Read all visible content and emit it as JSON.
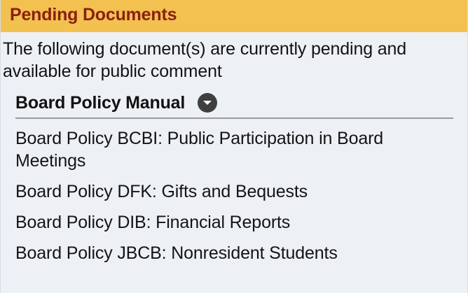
{
  "panel": {
    "title": "Pending Documents",
    "intro": "The following document(s) are currently pending and available for public comment",
    "header_bg": "#f2c14f",
    "title_color": "#8a1f12",
    "body_bg": "#edf1f6"
  },
  "section": {
    "title": "Board Policy Manual",
    "toggle_icon": "chevron-down-icon",
    "documents": [
      {
        "label": "Board Policy BCBI: Public Participation in Board Meetings"
      },
      {
        "label": "Board Policy DFK: Gifts and Bequests"
      },
      {
        "label": "Board Policy DIB: Financial Reports"
      },
      {
        "label": "Board Policy JBCB: Nonresident Students"
      }
    ]
  }
}
